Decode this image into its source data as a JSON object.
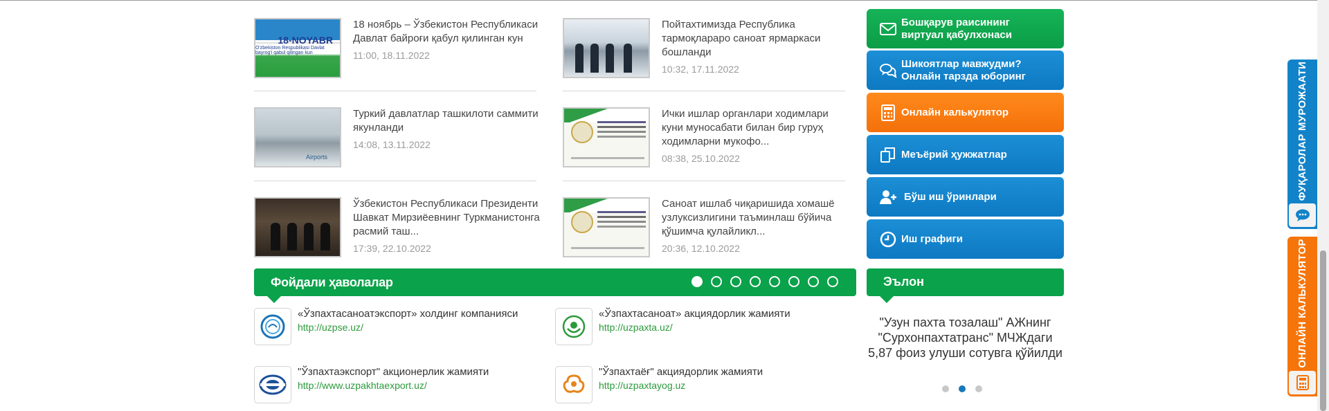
{
  "news": [
    {
      "title": "18 ноябрь – Ўзбекистон Республикаси Давлат байроғи қабул қилинган кун",
      "date": "11:00, 18.11.2022",
      "thumb_text": "18-NOYABR",
      "thumb_subtext": "O'zbekiston Respublikasi Davlat bayrog'i qabul qilingan kun"
    },
    {
      "title": "Пойтахтимизда Республика тармоқлараро саноат ярмаркаси бошланди",
      "date": "10:32, 17.11.2022"
    },
    {
      "title": "Туркий давлатлар ташкилоти саммити якунланди",
      "date": "14:08, 13.11.2022",
      "thumb_text": "Airports"
    },
    {
      "title": "Ички ишлар органлари ходимлари куни муносабати билан бир гуруҳ ходимларни мукофо...",
      "date": "08:38, 25.10.2022"
    },
    {
      "title": "Ўзбекистон Республикаси Президенти Шавкат Мирзиёевнинг Туркманистонга расмий таш...",
      "date": "17:39, 22.10.2022"
    },
    {
      "title": "Саноат ишлаб чиқаришида хомашё узлуксизлигини таъминлаш бўйича қўшимча қулайликл...",
      "date": "20:36, 12.10.2022"
    }
  ],
  "menu": [
    {
      "label": "Бошқарув раисининг виртуал қабулхонаси",
      "icon": "envelope-icon",
      "color": "#0aa24a"
    },
    {
      "label": "Шикоятлар мавжудми? Онлайн тарзда юборинг",
      "icon": "chat-bubbles-icon",
      "color": "#1383c9"
    },
    {
      "label": "Онлайн калькулятор",
      "icon": "calculator-icon",
      "color": "#f5750b"
    },
    {
      "label": "Меъёрий ҳужжатлар",
      "icon": "documents-icon",
      "color": "#1383c9"
    },
    {
      "label": "Бўш иш ўринлари",
      "icon": "add-user-icon",
      "color": "#1383c9"
    },
    {
      "label": "Иш графиги",
      "icon": "clock-icon",
      "color": "#1383c9"
    }
  ],
  "links": {
    "title": "Фойдали ҳаволалар",
    "page_count": 8,
    "active_page": 1,
    "items": [
      {
        "name": "«Ўзпахтасаноатэкспорт» холдинг компанияси",
        "url": "http://uzpse.uz/",
        "icon": "uzpse-logo"
      },
      {
        "name": "«Ўзпахтасаноат» акциядорлик жамияти",
        "url": "http://uzpaxta.uz/",
        "icon": "uzpaxta-logo"
      },
      {
        "name": "\"Ўзпахтаэкспорт\" акционерлик жамияти",
        "url": "http://www.uzpakhtaexport.uz/",
        "icon": "uzpakhtaexport-logo"
      },
      {
        "name": "\"Ўзпахтаёғ\" акциядорлик жамияти",
        "url": "http://uzpaxtayog.uz",
        "icon": "uzpaxtayog-logo"
      }
    ]
  },
  "announcement": {
    "title": "Эълон",
    "text": "\"Узун пахта тозалаш\" АЖнинг \"Сурхонпахтатранс\" МЧЖдаги 5,87 фоиз улуши сотувга қўйилди",
    "slide_count": 3,
    "active_slide": 2
  },
  "side_tabs": {
    "appeals": "ФУҚАРОЛАР МУРОЖААТИ",
    "calculator": "ОНЛАЙН КАЛЬКУЛЯТОР"
  },
  "colors": {
    "green": "#0aa24a",
    "blue": "#1383c9",
    "orange": "#f5750b",
    "link": "#2b9a3b"
  }
}
